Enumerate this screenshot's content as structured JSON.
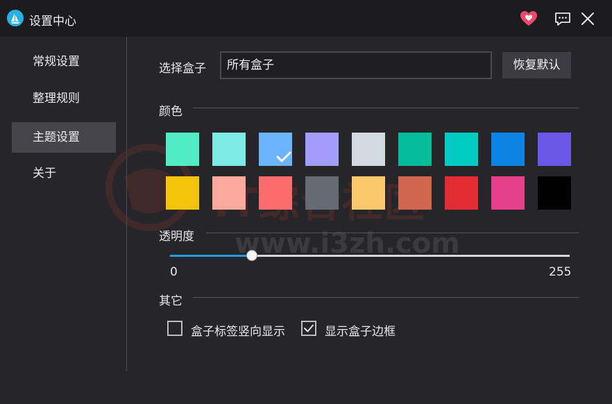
{
  "window": {
    "title": "设置中心",
    "heart_color": "#f2476b",
    "icons": [
      "app-logo-icon",
      "heart-icon",
      "feedback-icon",
      "close-icon"
    ]
  },
  "sidebar": {
    "items": [
      {
        "label": "常规设置",
        "active": false
      },
      {
        "label": "整理规则",
        "active": false
      },
      {
        "label": "主题设置",
        "active": true
      },
      {
        "label": "关于",
        "active": false
      }
    ]
  },
  "box_selector": {
    "label": "选择盒子",
    "value": "所有盒子",
    "reset_label": "恢复默认"
  },
  "color_section": {
    "title": "颜色",
    "selected_index": 2,
    "swatches": [
      "#52ecc4",
      "#7eeae6",
      "#6cb4fc",
      "#a49cfc",
      "#d4d8e0",
      "#04bc98",
      "#00ccc4",
      "#0c84e4",
      "#6c58e8",
      "#f4c40c",
      "#fca89c",
      "#fc6c6c",
      "#666a72",
      "#fcc86c",
      "#d0664e",
      "#e42c34",
      "#e63f8c",
      "#000000"
    ]
  },
  "transparency": {
    "title": "透明度",
    "min_label": "0",
    "max_label": "255",
    "value_fraction": 0.205
  },
  "other_section": {
    "title": "其它",
    "options": [
      {
        "label": "盒子标签竖向显示",
        "checked": false
      },
      {
        "label": "显示盒子边框",
        "checked": true
      }
    ]
  },
  "watermark": {
    "text": "IT综合社区",
    "url": "www.i3zh.com"
  },
  "colors": {
    "accent": "#1ea0e6",
    "background": "#26262a",
    "titlebar": "#1c1c1f"
  }
}
